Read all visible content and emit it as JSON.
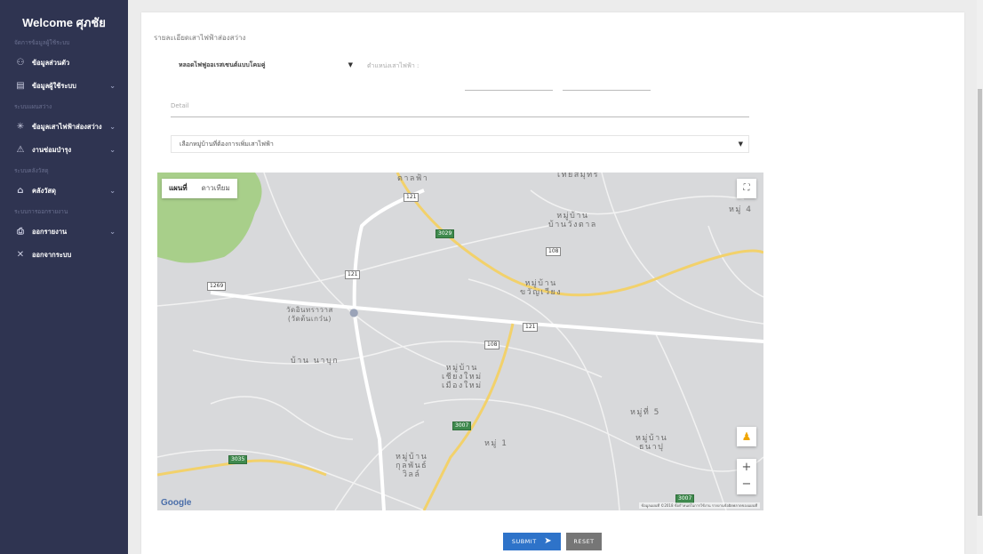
{
  "sidebar": {
    "welcome": "Welcome ศุภชัย",
    "sections": [
      "จัดการข้อมูลผู้ใช้ระบบ",
      "ระบบแผนสว่าง",
      "ระบบคลังวัสดุ",
      "ระบบการออกรายงาน"
    ],
    "items": [
      {
        "label": "ข้อมูลส่วนตัว",
        "icon": "user-icon",
        "chevron": ""
      },
      {
        "label": "ข้อมูลผู้ใช้ระบบ",
        "icon": "id-card-icon",
        "chevron": "⌄"
      },
      {
        "label": "ข้อมูลเสาไฟฟ้าส่องสว่าง",
        "icon": "light-icon",
        "chevron": "⌄"
      },
      {
        "label": "งานซ่อมบำรุง",
        "icon": "warning-icon",
        "chevron": "⌄"
      },
      {
        "label": "คลังวัสดุ",
        "icon": "home-icon",
        "chevron": "⌄"
      },
      {
        "label": "ออกรายงาน",
        "icon": "report-icon",
        "chevron": "⌄"
      },
      {
        "label": "ออกจากระบบ",
        "icon": "close-icon",
        "chevron": ""
      }
    ]
  },
  "form": {
    "title": "รายละเอียดเสาไฟฟ้าส่องสว่าง",
    "lamp_type": "หลอดไฟฟูออเรสเซนต์แบบโคมคู่",
    "position_label": "ตำแหน่งเสาไฟฟ้า :",
    "detail_placeholder": "Detail",
    "village_select": "เลือกหมู่บ้านที่ต้องการเพิ่มเสาไฟฟ้า"
  },
  "map": {
    "tabs": [
      "แผนที่",
      "ดาวเทียม"
    ],
    "places": {
      "p1": "ตาลฟ้า",
      "p2": "เทียสมุทร",
      "p3": "หมู่บ้าน\nบ้านวังตาล",
      "p4": "หมู่ 4",
      "p5": "หมู่บ้าน\nขวัญเวียง",
      "p6": "วัดอินทราวาส\n(วัดต้นเกว๋น)",
      "p7": "บ้าน นาบุก",
      "p8": "หมู่บ้าน\nเชียงใหม่\nเมืองใหม่",
      "p9": "หมู่ที่ 5",
      "p10": "หมู่ 1",
      "p11": "หมู่บ้าน\nธนาปุ",
      "p12": "หมู่บ้าน\nกุลพันธ์\nวิลล์"
    },
    "shields": {
      "s121a": "121",
      "s3029": "3029",
      "s108a": "108",
      "s1269": "1269",
      "s121b": "121",
      "s121c": "121",
      "s108b": "108",
      "s3007a": "3007",
      "s3035": "3035",
      "s3007b": "3007"
    },
    "google": "Google",
    "attribution": "ข้อมูลแผนที่ ©2018   ข้อกำหนดในการใช้งาน   รายงานข้อผิดพลาดของแผนที่",
    "zoom_in": "+",
    "zoom_out": "−"
  },
  "buttons": {
    "submit": "SUBMIT",
    "reset": "RESET"
  },
  "colors": {
    "sidebar": "#2f3451",
    "submit": "#2e73c9",
    "reset": "#767676"
  }
}
